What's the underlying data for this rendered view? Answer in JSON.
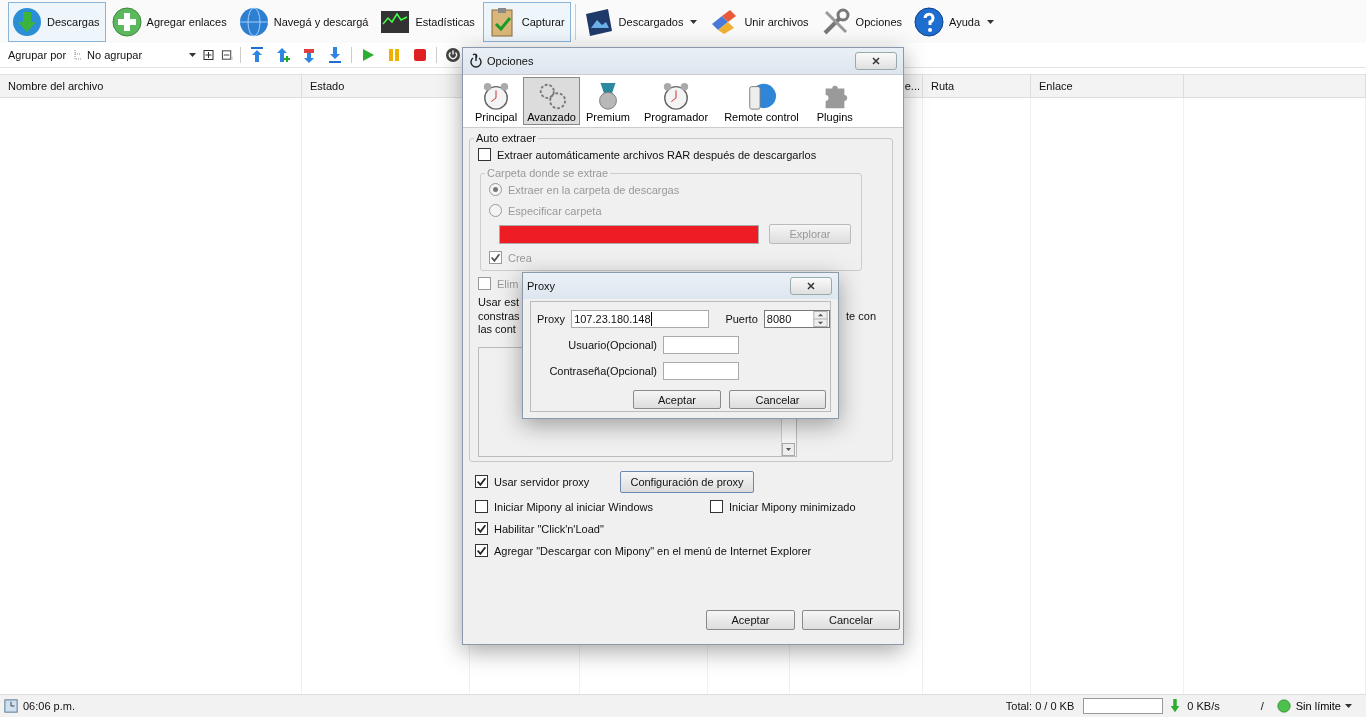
{
  "toolbar": [
    {
      "label": "Descargas",
      "selected": true,
      "dropdown": false
    },
    {
      "label": "Agregar enlaces",
      "selected": false,
      "dropdown": false
    },
    {
      "label": "Navegá y descargá",
      "selected": false,
      "dropdown": false
    },
    {
      "label": "Estadísticas",
      "selected": false,
      "dropdown": false
    },
    {
      "label": "Capturar",
      "selected": true,
      "dropdown": false
    },
    {
      "label": "Descargados",
      "selected": false,
      "dropdown": true
    },
    {
      "label": "Unir archivos",
      "selected": false,
      "dropdown": false
    },
    {
      "label": "Opciones",
      "selected": false,
      "dropdown": false
    },
    {
      "label": "Ayuda",
      "selected": false,
      "dropdown": true
    }
  ],
  "group_bar": {
    "label": "Agrupar por",
    "value": "No agrupar"
  },
  "columns": [
    {
      "label": "Nombre del archivo"
    },
    {
      "label": "Estado"
    },
    {
      "label": "e..."
    },
    {
      "label": "Ruta"
    },
    {
      "label": "Enlace"
    }
  ],
  "status_bar": {
    "time": "06:06 p.m.",
    "total": "Total: 0 / 0 KB",
    "speed": "0 KB/s",
    "separator": "/",
    "limit": "Sin límite"
  },
  "options_dialog": {
    "title": "Opciones",
    "tabs": [
      {
        "label": "Principal",
        "selected": false
      },
      {
        "label": "Avanzado",
        "selected": true
      },
      {
        "label": "Premium",
        "selected": false
      },
      {
        "label": "Programador",
        "selected": false
      },
      {
        "label": "Remote control",
        "selected": false
      },
      {
        "label": "Plugins",
        "selected": false
      }
    ],
    "auto_extract": {
      "title": "Auto extraer",
      "checkbox": {
        "label": "Extraer automáticamente archivos RAR después de descargarlos",
        "checked": false
      },
      "folder_group": {
        "title": "Carpeta donde se extrae",
        "disabled": true,
        "radios": [
          {
            "label": "Extraer en la carpeta de descargas",
            "selected": true
          },
          {
            "label": "Especificar carpeta",
            "selected": false
          }
        ],
        "browse_button": "Explorar"
      },
      "create_option": {
        "label": "Crea",
        "checked": true,
        "disabled": true
      },
      "delete_option": {
        "label": "Elim",
        "checked": false,
        "disabled": true
      },
      "note_left": [
        "Usar est",
        "constras",
        "las cont"
      ],
      "note_right": "te con"
    },
    "proxy_row": {
      "checkbox": {
        "label": "Usar servidor proxy",
        "checked": true
      },
      "button": "Configuración de proxy"
    },
    "startup_row": [
      {
        "label": "Iniciar Mipony al iniciar Windows",
        "checked": false
      },
      {
        "label": "Iniciar Mipony minimizado",
        "checked": false
      }
    ],
    "options": [
      {
        "label": "Habilitar \"Click'n'Load\"",
        "checked": true
      },
      {
        "label": "Agregar \"Descargar con Mipony\" en el menú de Internet Explorer",
        "checked": true
      }
    ],
    "buttons": [
      "Aceptar",
      "Cancelar"
    ]
  },
  "proxy_dialog": {
    "title": "Proxy",
    "proxy_label": "Proxy",
    "proxy_value": "107.23.180.148",
    "port_label": "Puerto",
    "port_value": "8080",
    "user_label": "Usuario(Opcional)",
    "password_label": "Contraseña(Opcional)",
    "buttons": [
      "Aceptar",
      "Cancelar"
    ]
  }
}
